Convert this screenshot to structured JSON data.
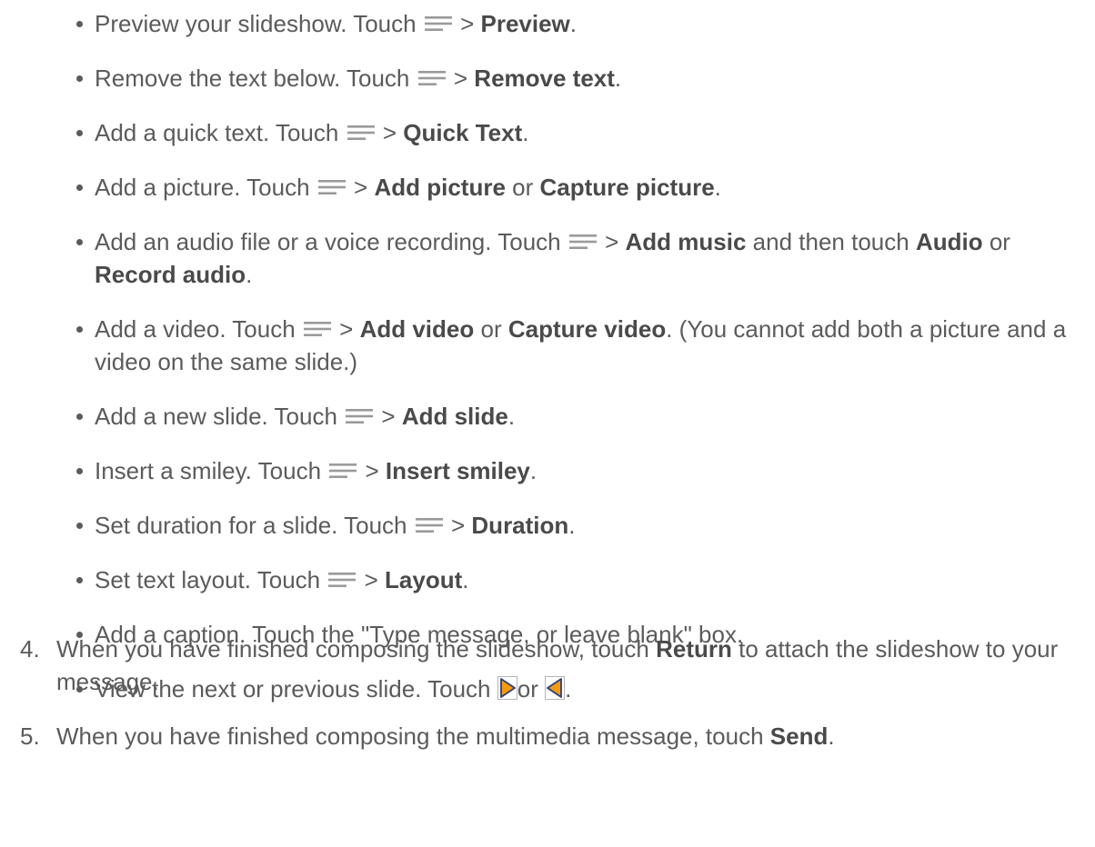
{
  "bullets": [
    {
      "text": "Preview your slideshow. Touch",
      "sep": ">",
      "bold1": "Preview",
      "end": "."
    },
    {
      "text": "Remove the text below. Touch",
      "sep": ">",
      "bold1": "Remove text",
      "end": "."
    },
    {
      "text": "Add a quick text. Touch",
      "sep": ">",
      "bold1": "Quick Text",
      "end": "."
    },
    {
      "text": "Add a picture. Touch",
      "sep": ">",
      "bold1": "Add picture",
      "mid": "or",
      "bold2": "Capture picture",
      "end": "."
    },
    {
      "text": "Add an audio file or a voice recording. Touch",
      "sep": ">",
      "bold1": "Add music",
      "mid": "and then touch",
      "bold2": "Audio",
      "mid2": "or",
      "bold3": "Record audio",
      "end": "."
    },
    {
      "text": "Add a video. Touch",
      "sep": ">",
      "bold1": "Add video",
      "mid": "or",
      "bold2": "Capture video",
      "end": ". (You cannot add both a picture and a video on the same slide.)"
    },
    {
      "text": "Add a new slide. Touch",
      "sep": ">",
      "bold1": "Add slide",
      "end": "."
    },
    {
      "text": "Insert a smiley. Touch",
      "sep": ">",
      "bold1": "Insert smiley",
      "end": "."
    },
    {
      "text": "Set duration for a slide. Touch",
      "sep": ">",
      "bold1": "Duration",
      "end": "."
    },
    {
      "text": "Set text layout. Touch",
      "sep": ">",
      "bold1": "Layout",
      "end": "."
    },
    {
      "text": "Add a caption. Touch the \"Type message, or leave blank\" box."
    },
    {
      "text": "View the next or previous slide. Touch",
      "mid": "or",
      "end": "."
    }
  ],
  "steps": [
    {
      "num": "4.",
      "text": "When you have finished composing the slideshow, touch",
      "bold": "Return",
      "end": "to attach the slideshow to your message."
    },
    {
      "num": "5.",
      "text": "When you have finished composing the multimedia message, touch",
      "bold": "Send",
      "end": "."
    }
  ],
  "icons": {
    "menu": "menu-icon",
    "next": "next-slide-icon",
    "previous": "previous-slide-icon"
  },
  "colors": {
    "text": "#5b5b5b",
    "icon_gray": "#9a9a9a",
    "arrow_orange": "#f39c12",
    "arrow_outline": "#2c3e7a"
  }
}
